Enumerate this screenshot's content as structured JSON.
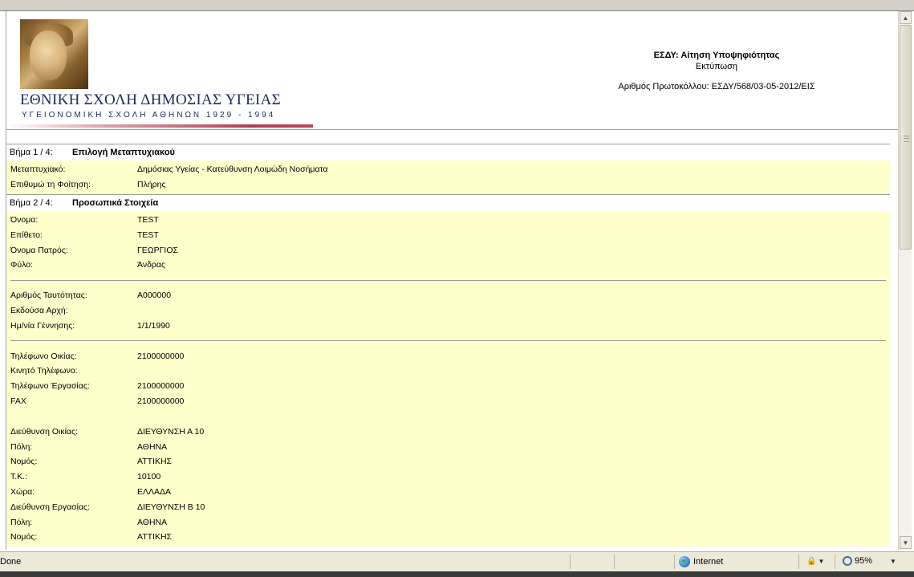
{
  "header": {
    "school_name": "ΕΘΝΙΚΗ ΣΧΟΛΗ ΔΗΜΟΣΙΑΣ ΥΓΕΙΑΣ",
    "school_subtitle": "ΥΓΕΙΟΝΟΜΙΚΗ ΣΧΟΛΗ ΑΘΗΝΩΝ 1929 - 1994",
    "doc_title": "ΕΣΔΥ: Αίτηση Υποψηφιότητας",
    "doc_print": "Εκτύπωση",
    "protocol": "Αριθμός Πρωτοκόλλου: ΕΣΔΥ/568/03-05-2012/ΕΙΣ"
  },
  "steps": [
    {
      "num": "Βήμα 1 / 4:",
      "title": "Επιλογή Μεταπτυχιακού",
      "groups": [
        [
          {
            "label": "Μεταπτυχιακό:",
            "value": "Δημόσιας Υγείας - Κατεύθυνση Λοιμώδη Νοσήματα"
          },
          {
            "label": "Επιθυμώ τη Φοίτηση:",
            "value": "Πλήρης"
          }
        ]
      ]
    },
    {
      "num": "Βήμα 2 / 4:",
      "title": "Προσωπικά Στοιχεία",
      "groups": [
        [
          {
            "label": "Όνομα:",
            "value": "TEST"
          },
          {
            "label": "Επίθετο:",
            "value": "TEST"
          },
          {
            "label": "Όνομα Πατρός:",
            "value": "ΓΕΩΡΓΙΟΣ"
          },
          {
            "label": "Φύλο:",
            "value": "Άνδρας"
          }
        ],
        [
          {
            "label": "Αριθμός Ταυτότητας:",
            "value": "Α000000"
          },
          {
            "label": "Εκδούσα Αρχή:",
            "value": ""
          },
          {
            "label": "Ημ/νία Γέννησης:",
            "value": "1/1/1990"
          }
        ],
        [
          {
            "label": "Τηλέφωνο Οικίας:",
            "value": "2100000000"
          },
          {
            "label": "Κινητό Τηλέφωνο:",
            "value": ""
          },
          {
            "label": "Τηλέφωνο Έργασίας:",
            "value": "2100000000"
          },
          {
            "label": "FAX",
            "value": "2100000000"
          }
        ],
        [
          {
            "label": "Διεύθυνση Οικίας:",
            "value": "ΔΙΕΥΘΥΝΣΗ Α 10"
          },
          {
            "label": "Πόλη:",
            "value": "ΑΘΗΝΑ"
          },
          {
            "label": "Νομός:",
            "value": "ΑΤΤΙΚΗΣ"
          },
          {
            "label": "Τ.Κ.:",
            "value": "10100"
          },
          {
            "label": "Χώρα:",
            "value": "ΕΛΛΑΔΑ"
          },
          {
            "label": "Διεύθυνση Εργασίας:",
            "value": "ΔΙΕΥΘΥΝΣΗ Β 10"
          },
          {
            "label": "Πόλη:",
            "value": "ΑΘΗΝΑ"
          },
          {
            "label": "Νομός:",
            "value": "ΑΤΤΙΚΗΣ"
          }
        ]
      ]
    }
  ],
  "statusbar": {
    "status": "Done",
    "zone": "Internet",
    "zoom": "95%"
  },
  "icons": {
    "zone": "globe-icon",
    "protected_mode": "lock-icon",
    "zoom": "magnifier-icon"
  }
}
